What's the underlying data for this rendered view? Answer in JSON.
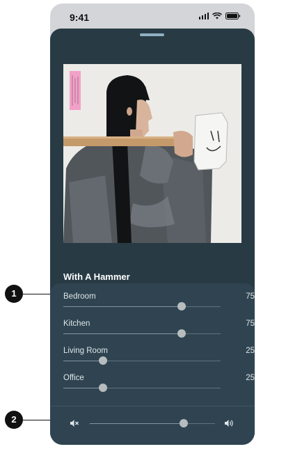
{
  "status_bar": {
    "time": "9:41"
  },
  "now_playing": {
    "title": "With A Hammer"
  },
  "rooms": [
    {
      "name": "Bedroom",
      "volume": 75,
      "slider_fraction": 0.75
    },
    {
      "name": "Kitchen",
      "volume": 75,
      "slider_fraction": 0.75
    },
    {
      "name": "Living Room",
      "volume": 25,
      "slider_fraction": 0.25
    },
    {
      "name": "Office",
      "volume": 25,
      "slider_fraction": 0.25
    }
  ],
  "master_volume": {
    "slider_fraction": 0.75
  },
  "callouts": [
    "1",
    "2"
  ],
  "colors": {
    "sheet": "#283b45",
    "panel": "#2f4450",
    "thumb": "#b7bcbf"
  }
}
